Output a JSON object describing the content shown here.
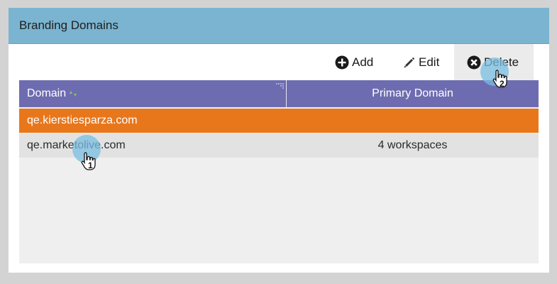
{
  "panel": {
    "title": "Branding Domains"
  },
  "toolbar": {
    "add_label": "Add",
    "edit_label": "Edit",
    "delete_label": "Delete",
    "icons": {
      "add": "plus-circle-icon",
      "edit": "pencil-icon",
      "delete": "x-circle-icon"
    }
  },
  "grid": {
    "columns": [
      {
        "label": "Domain",
        "icon": "sort-icon"
      },
      {
        "label": "Primary Domain"
      }
    ],
    "rows": [
      {
        "domain": "qe.kierstiesparza.com",
        "primary": "",
        "selected": true
      },
      {
        "domain": "qe.marketolive.com",
        "primary": "4 workspaces",
        "selected": false
      }
    ]
  },
  "callouts": [
    {
      "number": "1",
      "target": "row qe.marketolive.com"
    },
    {
      "number": "2",
      "target": "delete-button"
    }
  ],
  "colors": {
    "header_bg": "#7bb4d0",
    "grid_header_bg": "#6e6cb0",
    "selected_row_bg": "#e8771c",
    "row_bg": "#e2e2e2",
    "page_bg": "#d3d3d3"
  }
}
